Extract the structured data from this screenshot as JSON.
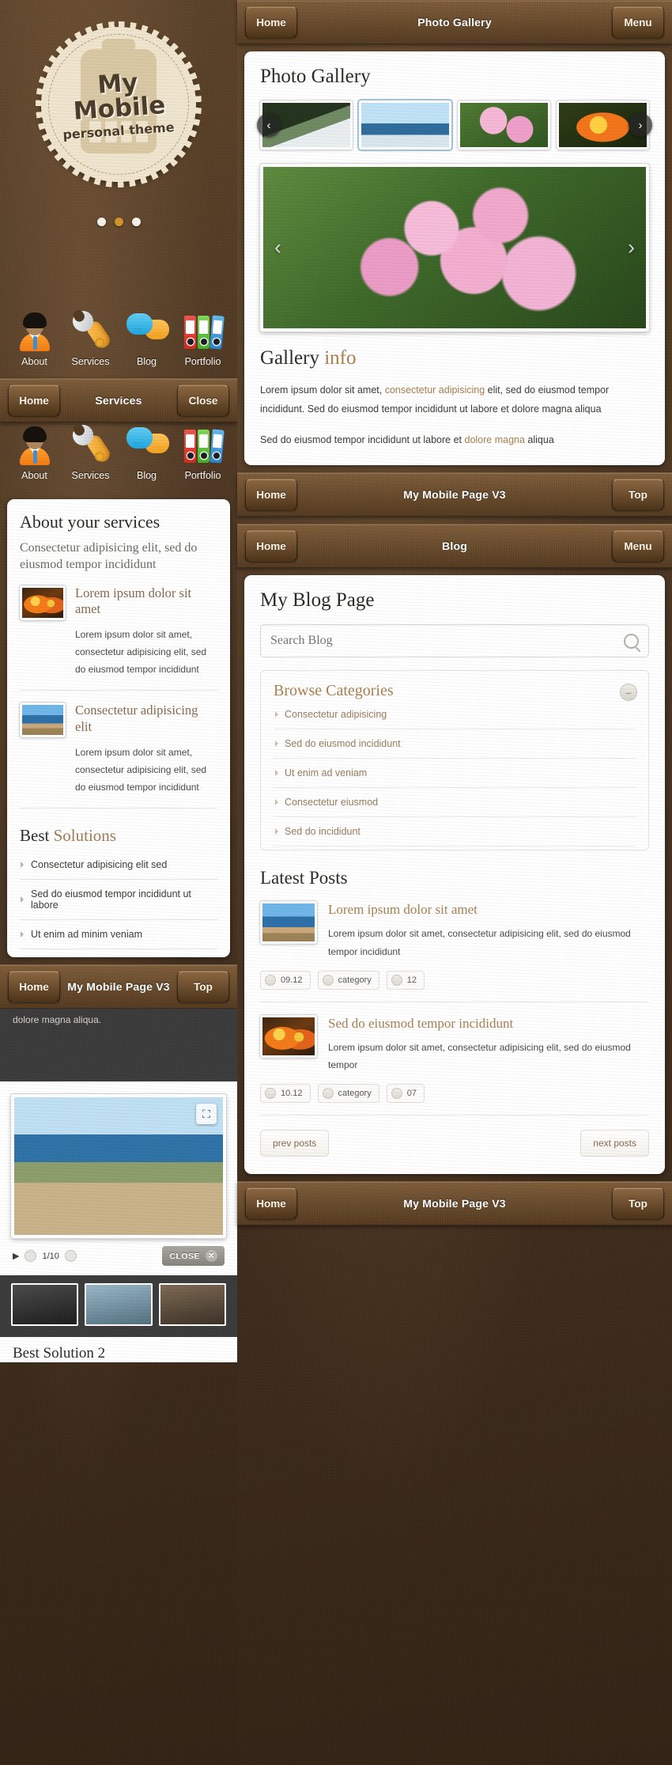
{
  "splash": {
    "badge_line1": "My Mobile",
    "badge_line2": "personal theme",
    "dots": [
      "",
      "",
      ""
    ]
  },
  "icons": [
    {
      "label": "About",
      "icon": "user-icon"
    },
    {
      "label": "Services",
      "icon": "wrench-icon"
    },
    {
      "label": "Blog",
      "icon": "chat-bubbles-icon"
    },
    {
      "label": "Portfolio",
      "icon": "binders-icon"
    }
  ],
  "nav_services": {
    "home": "Home",
    "title": "Services",
    "close": "Close"
  },
  "about_panel": {
    "title": "About your services",
    "lead": "Consectetur adipisicing elit, sed do eiusmod tempor incididunt",
    "services": [
      {
        "title": "Lorem ipsum dolor sit amet",
        "text": "Lorem ipsum dolor sit amet, consectetur adipisicing elit, sed do eiusmod tempor incididunt",
        "thumb": "flower-thumbnail"
      },
      {
        "title": "Consectetur adipisicing elit",
        "text": "Lorem ipsum dolor sit amet, consectetur adipisicing elit, sed do eiusmod tempor incididunt",
        "thumb": "coast-thumbnail"
      }
    ],
    "best_word1": "Best",
    "best_word2": "Solutions",
    "best_items": [
      "Consectetur adipisicing elit sed",
      "Sed do eiusmod tempor incididunt ut labore",
      "Ut enim ad minim veniam"
    ]
  },
  "nav_bottom_left": {
    "home": "Home",
    "title": "My Mobile Page V3",
    "top": "Top"
  },
  "lightbox": {
    "fragment_text": "dolore magna aliqua.",
    "counter": "1/10",
    "close": "CLOSE",
    "bottom_heading": "Best Solution 2"
  },
  "nav_gallery": {
    "home": "Home",
    "title": "Photo Gallery",
    "menu": "Menu"
  },
  "gallery": {
    "title": "Photo Gallery",
    "thumbs": [
      "seagull",
      "sailboat",
      "pink-flowers",
      "orange-flower"
    ],
    "prev": "‹",
    "next": "›",
    "info_word1": "Gallery",
    "info_word2": "info",
    "p1_a": "Lorem ipsum dolor sit amet, ",
    "p1_hl": "consectetur adipisicing",
    "p1_b": " elit, sed do eiusmod tempor incididunt. Sed do eiusmod tempor incididunt ut labore et dolore magna aliqua",
    "p2_a": "Sed do eiusmod tempor incididunt ut labore et ",
    "p2_hl": "dolore magna",
    "p2_b": " aliqua"
  },
  "nav_mid": {
    "home": "Home",
    "title": "My Mobile Page V3",
    "top": "Top"
  },
  "nav_blog": {
    "home": "Home",
    "title": "Blog",
    "menu": "Menu"
  },
  "blog": {
    "title": "My Blog Page",
    "search_placeholder": "Search Blog",
    "search_value": "",
    "categories_title": "Browse Categories",
    "categories": [
      "Consectetur adipisicing",
      "Sed do eiusmod incididunt",
      "Ut enim ad veniam",
      "Consectetur eiusmod",
      "Sed do incididunt"
    ],
    "latest_title": "Latest Posts",
    "posts": [
      {
        "title": "Lorem ipsum dolor sit amet",
        "text": "Lorem ipsum dolor sit amet, consectetur adipisicing elit, sed do eiusmod tempor incididunt",
        "date": "09.12",
        "category": "category",
        "comments": "12",
        "thumb": "coast-thumbnail"
      },
      {
        "title": "Sed do eiusmod tempor incididunt",
        "text": "Lorem ipsum dolor sit amet, consectetur adipisicing elit, sed do eiusmod tempor",
        "date": "10.12",
        "category": "category",
        "comments": "07",
        "thumb": "flower-thumbnail"
      }
    ],
    "prev_posts": "prev posts",
    "next_posts": "next posts"
  },
  "nav_bottom_right": {
    "home": "Home",
    "title": "My Mobile Page V3",
    "top": "Top"
  },
  "colors": {
    "accent": "#a97f4e",
    "bar": "#6a4c2d",
    "bg": "#4a3522"
  }
}
